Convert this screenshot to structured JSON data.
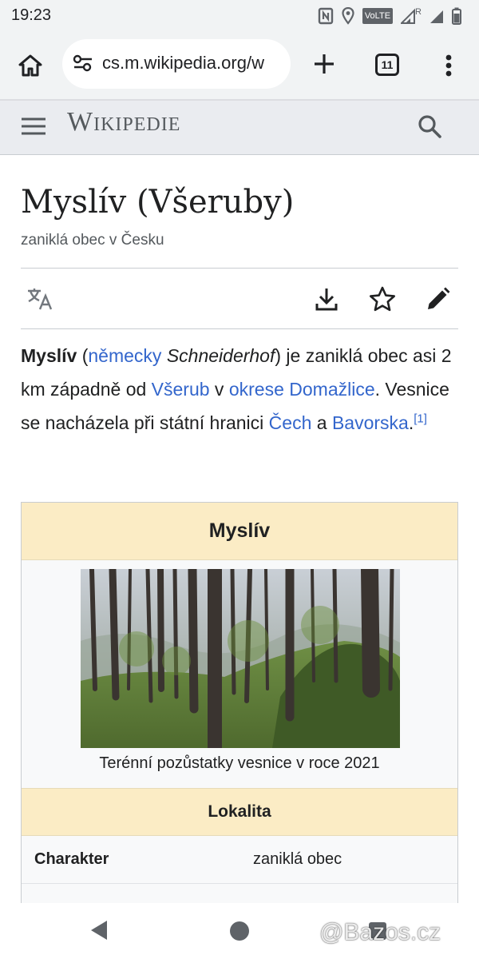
{
  "status_bar": {
    "time": "19:23",
    "volte_label": "VoLTE",
    "roaming_label": "R"
  },
  "browser": {
    "url": "cs.m.wikipedia.org/w",
    "tab_count": "11",
    "icons": [
      "home-icon",
      "site-settings-icon",
      "plus-icon",
      "tab-switcher-icon",
      "more-vert-icon"
    ]
  },
  "wiki": {
    "wordmark": "Wikipedie",
    "title": "Myslív (Všeruby)",
    "subtitle": "zaniklá obec v Česku",
    "actions": [
      "language-icon",
      "download-icon",
      "star-icon",
      "edit-icon"
    ]
  },
  "lead": {
    "term": "Myslív",
    "p1": " (",
    "link_german": "německy",
    "p2": " ",
    "german_name": "Schneiderhof",
    "p3": ") je zaniklá obec asi 2 km západně od ",
    "link_vseruby": "Všerub",
    "p4": " v ",
    "link_okres": "okrese Domažlice",
    "p5": ". Vesnice se nacházela při státní hranici ",
    "link_cechy": "Čech",
    "p6": " a ",
    "link_bavorsko": "Bavorska",
    "p7": ".",
    "ref": "[1]"
  },
  "infobox": {
    "title": "Myslív",
    "image_caption": "Terénní pozůstatky vesnice v roce 2021",
    "section_lokalita": "Lokalita",
    "rows": [
      {
        "key": "Charakter",
        "value": "zaniklá obec"
      }
    ]
  },
  "watermark": "@Bazos.cz",
  "colors": {
    "link": "#3366cc",
    "infobox_header": "#fbecc5",
    "chrome_bar": "#f1f3f4",
    "wiki_header": "#eaecf0"
  }
}
